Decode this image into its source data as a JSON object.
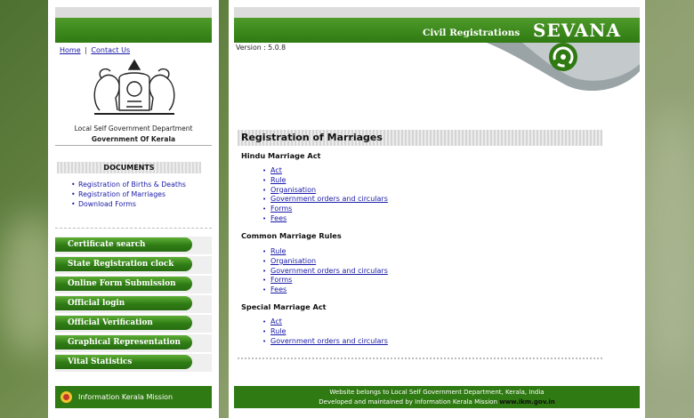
{
  "nav": {
    "home": "Home",
    "separator": "|",
    "contact": "Contact Us"
  },
  "dept": {
    "line1": "Local Self Government Department",
    "line2": "Government Of Kerala"
  },
  "documents": {
    "heading": "DOCUMENTS",
    "items": [
      "Registration of Births & Deaths",
      "Registration of Marriages",
      "Download Forms"
    ]
  },
  "side_buttons": [
    "Certificate search",
    "State Registration clock",
    "Online Form Submission",
    "Official login",
    "Official Verification",
    "Graphical Representation",
    "Vital Statistics"
  ],
  "left_footer": "Information Kerala Mission",
  "header": {
    "subtitle": "Civil Registrations",
    "brand": "SEVANA",
    "version": "Version : 5.0.8"
  },
  "page_title": "Registration of Marriages",
  "sections": [
    {
      "title": "Hindu Marriage Act",
      "links": [
        "Act",
        "Rule",
        "Organisation",
        "Government orders and circulars",
        "Forms",
        "Fees"
      ]
    },
    {
      "title": "Common Marriage Rules",
      "links": [
        "Rule",
        "Organisation",
        "Government orders and circulars",
        "Forms",
        "Fees"
      ]
    },
    {
      "title": "Special Marriage Act",
      "links": [
        "Act",
        "Rule",
        "Government orders and circulars"
      ]
    }
  ],
  "footer": {
    "line1": "Website belongs to Local Self Government Department, Kerala, India",
    "line2_prefix": "Developed and maintained by Information Kerala Mission",
    "line2_site": "www.ikm.gov.in"
  },
  "colors": {
    "green": "#2f7a12",
    "green_light": "#5fae35",
    "link": "#1a1aa8"
  }
}
